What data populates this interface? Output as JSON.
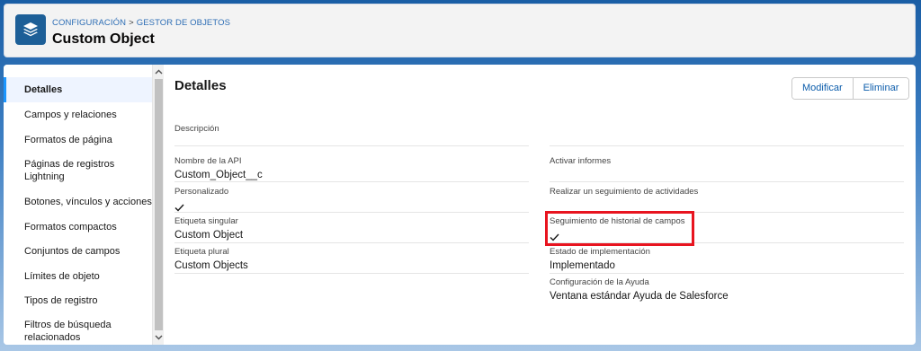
{
  "header": {
    "breadcrumb_1": "CONFIGURACIÓN",
    "breadcrumb_sep": ">",
    "breadcrumb_2": "GESTOR DE OBJETOS",
    "title": "Custom Object",
    "logo_icon": "layers-icon"
  },
  "sidebar": {
    "items": [
      {
        "label": "Detalles"
      },
      {
        "label": "Campos y relaciones"
      },
      {
        "label": "Formatos de página"
      },
      {
        "label": "Páginas de registros Lightning"
      },
      {
        "label": "Botones, vínculos y acciones"
      },
      {
        "label": "Formatos compactos"
      },
      {
        "label": "Conjuntos de campos"
      },
      {
        "label": "Límites de objeto"
      },
      {
        "label": "Tipos de registro"
      },
      {
        "label": "Filtros de búsqueda relacionados"
      }
    ]
  },
  "main": {
    "title": "Detalles",
    "modify_label": "Modificar",
    "delete_label": "Eliminar",
    "description_label": "Descripción",
    "left": {
      "api_name_label": "Nombre de la API",
      "api_name_value": "Custom_Object__c",
      "custom_label": "Personalizado",
      "singular_label": "Etiqueta singular",
      "singular_value": "Custom Object",
      "plural_label": "Etiqueta plural",
      "plural_value": "Custom Objects"
    },
    "right": {
      "reports_label": "Activar informes",
      "activities_label": "Realizar un seguimiento de actividades",
      "history_label": "Seguimiento de historial de campos",
      "status_label": "Estado de implementación",
      "status_value": "Implementado",
      "help_label": "Configuración de la Ayuda",
      "help_value": "Ventana estándar Ayuda de Salesforce"
    }
  },
  "colors": {
    "accent": "#1b96ff",
    "link": "#0b5cab",
    "highlight": "#e8141f",
    "logo_bg": "#1d5f97"
  }
}
